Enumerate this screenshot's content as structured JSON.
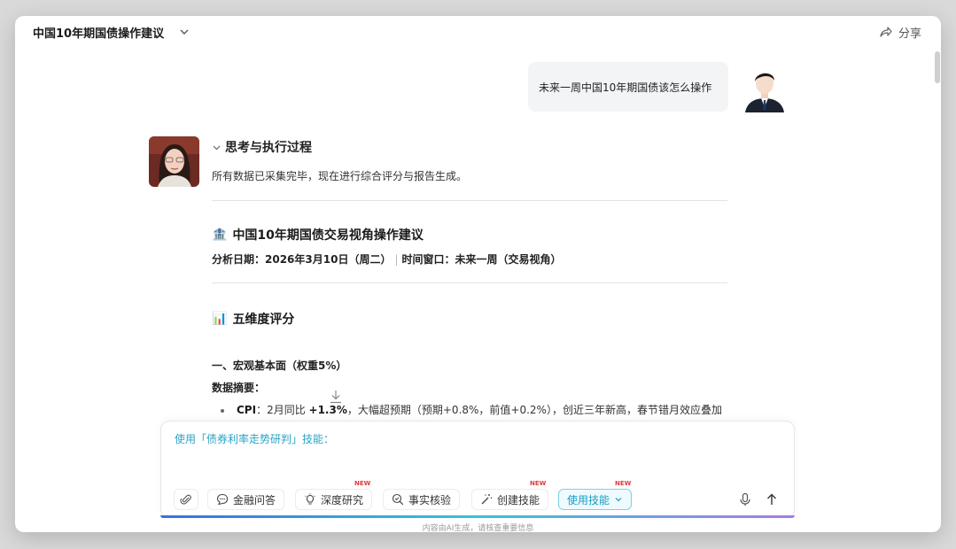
{
  "header": {
    "conversation_title": "中国10年期国债操作建议",
    "share_label": "分享"
  },
  "user_message": {
    "text": "未来一周中国10年期国债该怎么操作"
  },
  "assistant": {
    "thinking_title": "思考与执行过程",
    "thinking_text": "所有数据已采集完毕，现在进行综合评分与报告生成。",
    "report_icon": "🏦",
    "report_title": "中国10年期国债交易视角操作建议",
    "meta_date": "分析日期：2026年3月10日（周二）",
    "meta_separator": "|",
    "meta_window": "时间窗口：未来一周（交易视角）",
    "dimension_icon": "📊",
    "dimension_title": "五维度评分",
    "macro_heading": "一、宏观基本面（权重5%）",
    "summary_heading": "数据摘要：",
    "bullet_label": "CPI",
    "bullet_text_a": "：2月同比 ",
    "bullet_value": "+1.3%",
    "bullet_text_b": "，大幅超预期（预期+0.8%，前值+0.2%），创近三年新高，春节错月效应叠加"
  },
  "composer": {
    "prompt_text": "使用「债券利率走势研判」技能：",
    "tools": {
      "finance_qa": "金融问答",
      "deep_research": "深度研究",
      "fact_check": "事实核验",
      "create_skill": "创建技能",
      "use_skill": "使用技能"
    },
    "new_badge": "NEW"
  },
  "footer": {
    "disclaimer": "内容由AI生成，请核查重要信息"
  },
  "colors": {
    "accent": "#2aa4c6",
    "new_badge": "#e0393e"
  }
}
